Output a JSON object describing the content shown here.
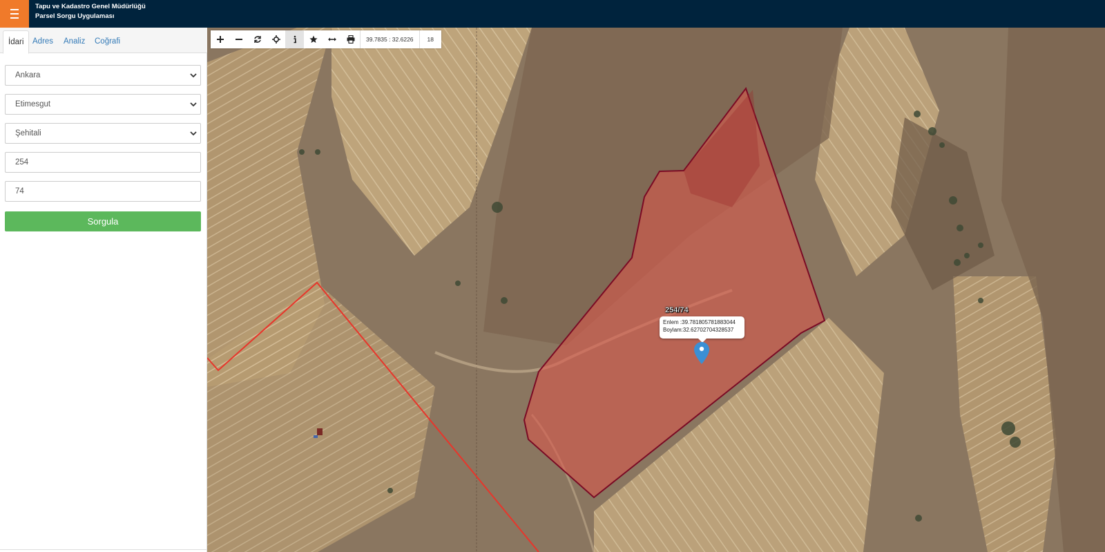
{
  "header": {
    "title_line1": "Tapu ve Kadastro Genel Müdürlüğü",
    "title_line2": "Parsel Sorgu Uygulaması",
    "menu_icon": "hamburger-icon",
    "brand_color": "#00233d",
    "accent_color": "#f07a2a"
  },
  "sidebar": {
    "tabs": [
      {
        "label": "İdari",
        "active": true
      },
      {
        "label": "Adres",
        "active": false
      },
      {
        "label": "Analiz",
        "active": false
      },
      {
        "label": "Coğrafi",
        "active": false
      }
    ],
    "form": {
      "province": "Ankara",
      "district": "Etimesgut",
      "neighborhood": "Şehitali",
      "block": "254",
      "parcel": "74",
      "submit_label": "Sorgula",
      "submit_color": "#5cb85c"
    }
  },
  "map": {
    "toolbar": {
      "icons": [
        "zoom-in-icon",
        "zoom-out-icon",
        "refresh-icon",
        "locate-icon",
        "info-icon",
        "star-icon",
        "measure-icon",
        "print-icon"
      ],
      "coords": "39.7835 : 32.6226",
      "zoom": "18"
    },
    "parcel_label": "254/74",
    "popup": {
      "lat_line": "Enlem :39.781805781883044",
      "lon_line": "Boylam:32.62702704328537"
    },
    "parcel_fill": "#d9594d",
    "parcel_stroke": "#7a0a24",
    "boundary_color": "#e8352b"
  }
}
